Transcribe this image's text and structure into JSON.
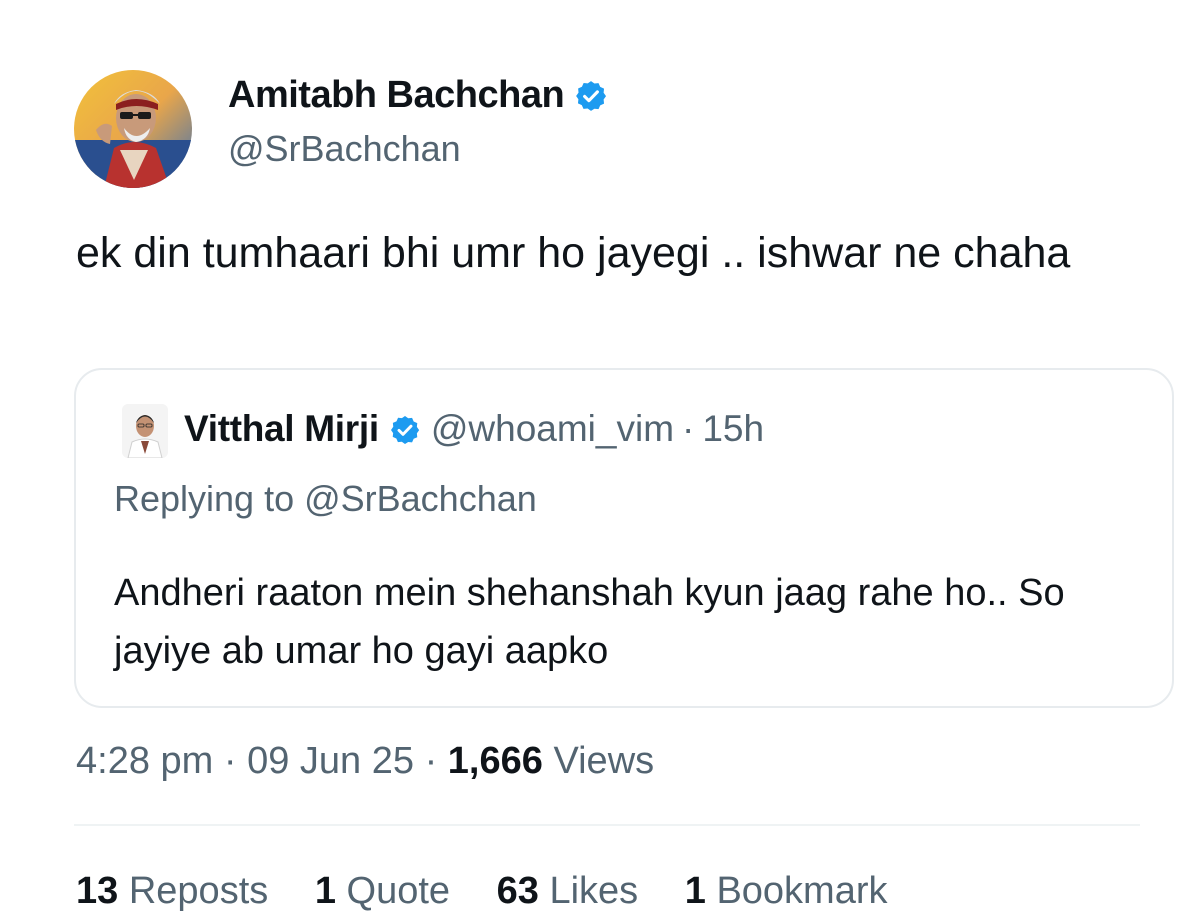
{
  "author": {
    "name": "Amitabh Bachchan",
    "handle": "@SrBachchan"
  },
  "tweet": {
    "text": "ek din tumhaari bhi umr ho jayegi .. ishwar ne chaha"
  },
  "quoted": {
    "name": "Vitthal Mirji",
    "handle": "@whoami_vim",
    "separator": "·",
    "time": "15h",
    "replying_to": "Replying to @SrBachchan",
    "text": "Andheri raaton mein shehanshah kyun jaag rahe ho.. So jayiye ab umar ho gayi aapko"
  },
  "meta": {
    "time": "4:28 pm",
    "sep1": "·",
    "date": "09 Jun 25",
    "sep2": "·",
    "views_count": "1,666",
    "views_label": "Views"
  },
  "stats": {
    "reposts_count": "13",
    "reposts_label": "Reposts",
    "quotes_count": "1",
    "quotes_label": "Quote",
    "likes_count": "63",
    "likes_label": "Likes",
    "bookmarks_count": "1",
    "bookmarks_label": "Bookmark"
  },
  "colors": {
    "verified": "#1d9bf0",
    "secondary_text": "#536471",
    "primary_text": "#0f1419"
  }
}
